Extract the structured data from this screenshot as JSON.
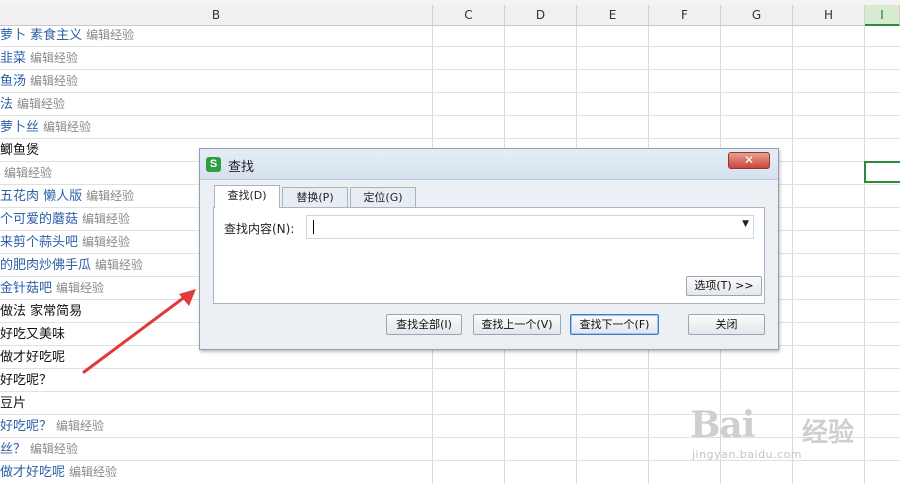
{
  "sheet": {
    "columns": [
      {
        "label": "B"
      },
      {
        "label": "C"
      },
      {
        "label": "D"
      },
      {
        "label": "E"
      },
      {
        "label": "F"
      },
      {
        "label": "G"
      },
      {
        "label": "H"
      },
      {
        "label": "I"
      }
    ],
    "rows": [
      {
        "main": "萝卜 素食主义",
        "sub": "编辑经验",
        "style": "blue"
      },
      {
        "main": "韭菜",
        "sub": "编辑经验",
        "style": "blue"
      },
      {
        "main": "鱼汤",
        "sub": "编辑经验",
        "style": "blue"
      },
      {
        "main": "法",
        "sub": "编辑经验",
        "style": "blue"
      },
      {
        "main": "萝卜丝",
        "sub": "编辑经验",
        "style": "blue"
      },
      {
        "main": "鲫鱼煲",
        "sub": "",
        "style": "black"
      },
      {
        "main": "",
        "sub": "编辑经验",
        "style": "blue"
      },
      {
        "main": "五花肉 懒人版",
        "sub": "编辑经验",
        "style": "blue"
      },
      {
        "main": "个可爱的蘑菇",
        "sub": "编辑经验",
        "style": "blue"
      },
      {
        "main": "来剪个蒜头吧",
        "sub": "编辑经验",
        "style": "blue"
      },
      {
        "main": "的肥肉炒佛手瓜",
        "sub": "编辑经验",
        "style": "blue"
      },
      {
        "main": "金针菇吧",
        "sub": "编辑经验",
        "style": "blue"
      },
      {
        "main": "做法 家常简易",
        "sub": "",
        "style": "black"
      },
      {
        "main": "好吃又美味",
        "sub": "",
        "style": "black"
      },
      {
        "main": "做才好吃呢",
        "sub": "",
        "style": "black"
      },
      {
        "main": "好吃呢？",
        "sub": "",
        "style": "black"
      },
      {
        "main": "豆片",
        "sub": "",
        "style": "black"
      },
      {
        "main": "好吃呢？",
        "sub": "编辑经验",
        "style": "blue"
      },
      {
        "main": "丝？",
        "sub": "编辑经验",
        "style": "blue"
      },
      {
        "main": "做才好吃呢",
        "sub": "编辑经验",
        "style": "blue"
      }
    ]
  },
  "dialog": {
    "app_icon": "S",
    "title": "查找",
    "close_symbol": "✕",
    "tabs": [
      {
        "label": "查找(D)"
      },
      {
        "label": "替换(P)"
      },
      {
        "label": "定位(G)"
      }
    ],
    "field_label": "查找内容(N):",
    "search_value": "",
    "options_button": "选项(T) >>",
    "buttons": {
      "find_all": "查找全部(I)",
      "find_prev": "查找上一个(V)",
      "find_next": "查找下一个(F)",
      "close": "关闭"
    }
  },
  "watermark": {
    "brand": "Bai",
    "brand_cn": "经验",
    "url": "jingyan.baidu.com"
  },
  "colors": {
    "accent_green": "#2a8a3a",
    "link_blue": "#2c5fa8",
    "arrow_red": "#e03a3a"
  }
}
